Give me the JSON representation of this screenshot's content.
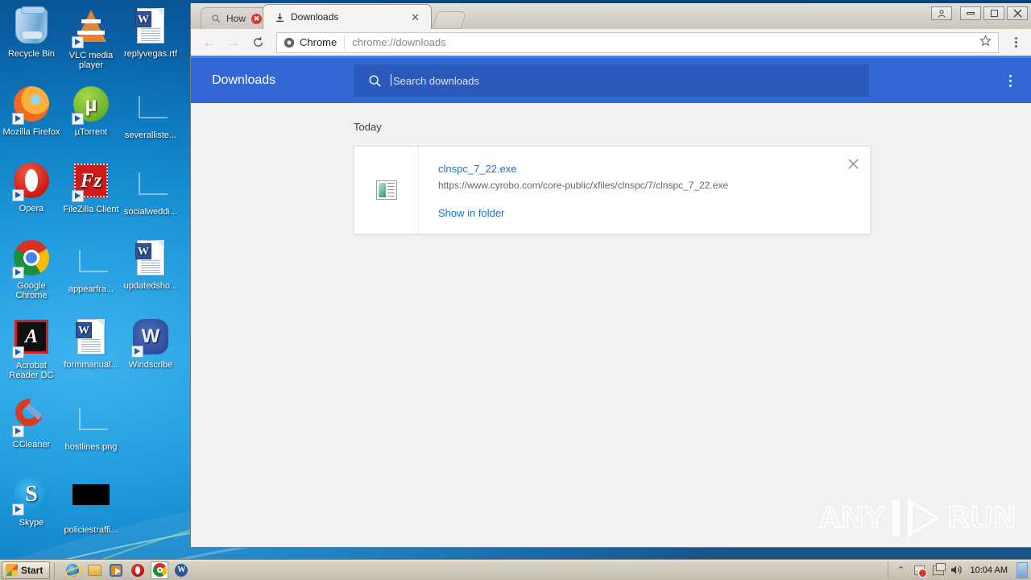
{
  "desktop": {
    "icons": [
      {
        "label": "Recycle Bin",
        "icon": "recycle-bin-icon",
        "shortcut": false,
        "col": 0,
        "row": 0
      },
      {
        "label": "VLC media player",
        "icon": "vlc-media-player-icon",
        "shortcut": true,
        "col": 1,
        "row": 0
      },
      {
        "label": "replyvegas.rtf",
        "icon": "word-document-icon",
        "shortcut": false,
        "col": 2,
        "row": 0
      },
      {
        "label": "Mozilla Firefox",
        "icon": "firefox-icon",
        "shortcut": true,
        "col": 0,
        "row": 1
      },
      {
        "label": "µTorrent",
        "icon": "utorrent-icon",
        "shortcut": true,
        "col": 1,
        "row": 1
      },
      {
        "label": "severalliste...",
        "icon": "clipped-file-icon",
        "shortcut": false,
        "col": 2,
        "row": 1
      },
      {
        "label": "Opera",
        "icon": "opera-icon",
        "shortcut": true,
        "col": 0,
        "row": 2
      },
      {
        "label": "FileZilla Client",
        "icon": "filezilla-icon",
        "shortcut": true,
        "col": 1,
        "row": 2
      },
      {
        "label": "socialweddi...",
        "icon": "clipped-file-icon",
        "shortcut": false,
        "col": 2,
        "row": 2
      },
      {
        "label": "Google Chrome",
        "icon": "chrome-icon",
        "shortcut": true,
        "col": 0,
        "row": 3
      },
      {
        "label": "appearfra...",
        "icon": "clipped-file-icon",
        "shortcut": false,
        "col": 1,
        "row": 3
      },
      {
        "label": "updatedsho...",
        "icon": "word-document-icon",
        "shortcut": false,
        "col": 2,
        "row": 3
      },
      {
        "label": "Acrobat Reader DC",
        "icon": "acrobat-reader-icon",
        "shortcut": true,
        "col": 0,
        "row": 4
      },
      {
        "label": "formmanual...",
        "icon": "word-document-icon",
        "shortcut": false,
        "col": 1,
        "row": 4
      },
      {
        "label": "Windscribe",
        "icon": "windscribe-icon",
        "shortcut": true,
        "col": 2,
        "row": 4
      },
      {
        "label": "CCleaner",
        "icon": "ccleaner-icon",
        "shortcut": true,
        "col": 0,
        "row": 5
      },
      {
        "label": "hostlines.png",
        "icon": "clipped-file-icon",
        "shortcut": false,
        "col": 1,
        "row": 5
      },
      {
        "label": "Skype",
        "icon": "skype-icon",
        "shortcut": true,
        "col": 0,
        "row": 6
      },
      {
        "label": "policiestraffi...",
        "icon": "black-image-icon",
        "shortcut": false,
        "col": 1,
        "row": 6
      }
    ]
  },
  "browser": {
    "tabs": [
      {
        "title": "How",
        "favicon": "search-icon",
        "status": "error",
        "active": false
      },
      {
        "title": "Downloads",
        "favicon": "download-icon",
        "status": "loaded",
        "active": true
      }
    ],
    "new_tab_label": "",
    "window_controls": {
      "profile": "⚇",
      "minimize": "–",
      "maximize": "□",
      "close": "✕"
    },
    "toolbar": {
      "back": "←",
      "forward": "→",
      "reload": "⟳",
      "omnibox_brand": "Chrome",
      "omnibox_url": "chrome://downloads",
      "bookmark_star": "☆"
    }
  },
  "downloads_page": {
    "header_title": "Downloads",
    "search_placeholder": "Search downloads",
    "search_value": "",
    "date_group": "Today",
    "items": [
      {
        "name": "clnspc_7_22.exe",
        "url": "https://www.cyrobo.com/core-public/xfiles/clnspc/7/clnspc_7_22.exe",
        "action": "Show in folder",
        "close": "✕",
        "file_icon": "exe-file-icon"
      }
    ],
    "watermark": {
      "left": "ANY",
      "right": "RUN"
    }
  },
  "taskbar": {
    "start_label": "Start",
    "apps": [
      {
        "name": "internet-explorer",
        "active": false
      },
      {
        "name": "windows-explorer",
        "active": false
      },
      {
        "name": "windows-media-player",
        "active": false
      },
      {
        "name": "opera",
        "active": false
      },
      {
        "name": "google-chrome",
        "active": true
      },
      {
        "name": "microsoft-word",
        "active": false
      }
    ],
    "tray": {
      "show_hidden": "⌃",
      "action_center": "flag-icon",
      "network": "network-icon",
      "volume": "🔊",
      "clock": "10:04 AM"
    }
  },
  "colors": {
    "downloads_header_blue": "#3367d6",
    "omnibox_underline": "#4285f4",
    "link_blue": "#1a73c7",
    "page_bg": "#f1f1f1"
  }
}
